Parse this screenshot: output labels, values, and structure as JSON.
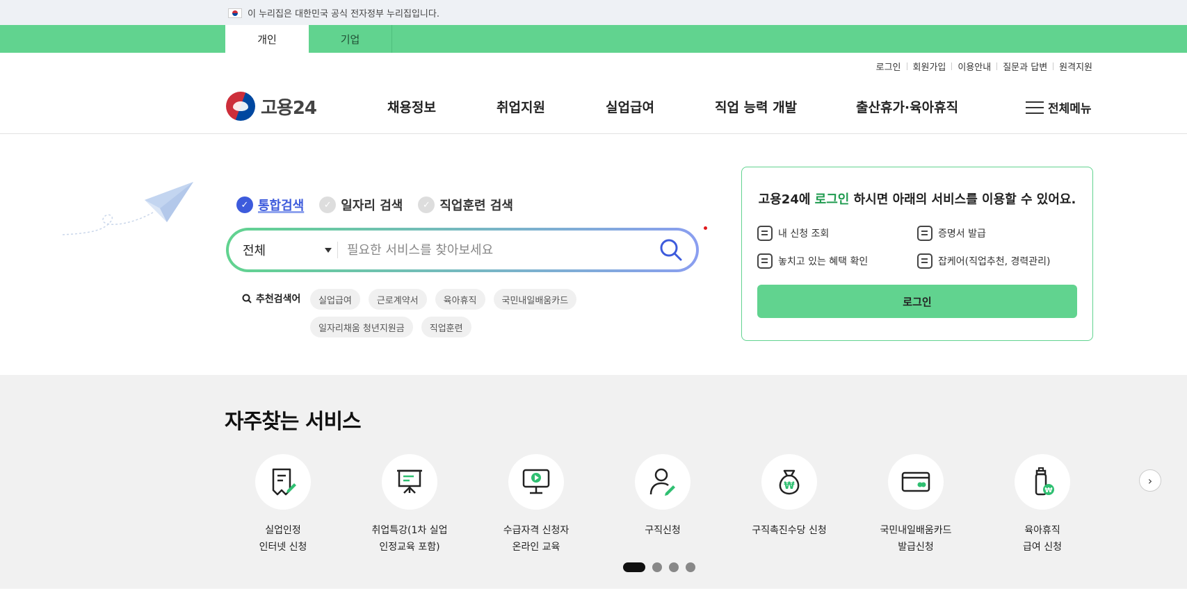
{
  "gov_banner": {
    "text": "이 누리집은 대한민국 공식 전자정부 누리집입니다."
  },
  "tabs": [
    {
      "label": "개인",
      "active": true
    },
    {
      "label": "기업",
      "active": false
    }
  ],
  "util_links": [
    "로그인",
    "회원가입",
    "이용안내",
    "질문과 답변",
    "원격지원"
  ],
  "logo": {
    "text": "고용24"
  },
  "gnb": [
    "채용정보",
    "취업지원",
    "실업급여",
    "직업 능력 개발",
    "출산휴가·육아휴직"
  ],
  "all_menu": "전체메뉴",
  "search": {
    "tabs": [
      {
        "label": "통합검색",
        "active": true
      },
      {
        "label": "일자리 검색",
        "active": false
      },
      {
        "label": "직업훈련 검색",
        "active": false
      }
    ],
    "scope": "전체",
    "placeholder": "필요한 서비스를 찾아보세요",
    "recommend_label": "추천검색어",
    "keywords": [
      "실업급여",
      "근로계약서",
      "육아휴직",
      "국민내일배움카드",
      "일자리채움 청년지원금",
      "직업훈련"
    ]
  },
  "login_box": {
    "title_pre": "고용24에 ",
    "title_link": "로그인",
    "title_post": " 하시면 아래의 서비스를 이용할 수 있어요.",
    "items": [
      "내 신청 조회",
      "증명서 발급",
      "놓치고 있는 혜택 확인",
      "잡케어(직업추천, 경력관리)"
    ],
    "button": "로그인"
  },
  "services": {
    "title": "자주찾는 서비스",
    "items": [
      {
        "line1": "실업인정",
        "line2": "인터넷 신청",
        "icon": "document-pen-icon"
      },
      {
        "line1": "취업특강(1차 실업",
        "line2": "인정교육 포함)",
        "icon": "presentation-board-icon"
      },
      {
        "line1": "수급자격 신청자",
        "line2": "온라인 교육",
        "icon": "monitor-play-icon"
      },
      {
        "line1": "구직신청",
        "line2": "",
        "icon": "person-pen-icon"
      },
      {
        "line1": "구직촉진수당 신청",
        "line2": "",
        "icon": "money-bag-icon"
      },
      {
        "line1": "국민내일배움카드",
        "line2": "발급신청",
        "icon": "card-icon"
      },
      {
        "line1": "육아휴직",
        "line2": "급여 신청",
        "icon": "baby-bottle-icon"
      }
    ],
    "page_count": 4,
    "current_page": 1
  },
  "colors": {
    "brand_green": "#61d38f",
    "accent_blue": "#3d5bdc"
  }
}
